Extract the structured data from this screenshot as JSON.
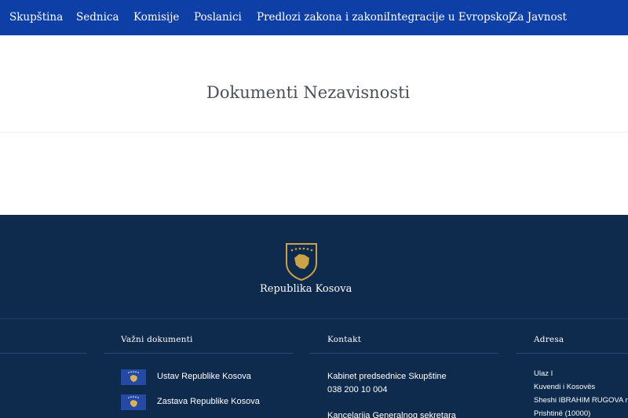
{
  "nav": {
    "items": [
      {
        "label": "Skupština"
      },
      {
        "label": "Sednica"
      },
      {
        "label": "Komisije"
      },
      {
        "label": "Poslanici"
      },
      {
        "label": "Predlozi zakona i zakoni"
      },
      {
        "label": "Integracije u Evropskoj"
      },
      {
        "label": "Za Javnost"
      }
    ]
  },
  "page": {
    "title": "Dokumenti Nezavisnosti"
  },
  "footer": {
    "emblem_icon": "kosovo-coat-of-arms-icon",
    "republic_name": "Republika Kosova",
    "colors": {
      "navbar": "#0d3fa6",
      "footer": "#0e2a4d",
      "emblem_gold": "#c9a24a"
    },
    "columns": {
      "documents": {
        "heading": "Važni dokumenti",
        "items": [
          {
            "label": "Ustav Republike Kosova",
            "icon": "kosovo-flag-icon"
          },
          {
            "label": "Zastava Republike Kosova",
            "icon": "kosovo-flag-icon"
          }
        ]
      },
      "contact": {
        "heading": "Kontakt",
        "lines": [
          "Kabinet predsednice Skupštine",
          "038 200 10 004",
          "Kancelarija Generalnog sekretara"
        ]
      },
      "address": {
        "heading": "Adresa",
        "lines": [
          "Ulaz I",
          "Kuvendi i Kosovës",
          "Sheshi IBRAHIM RUGOVA n",
          "Prishtinë (10000)"
        ]
      }
    }
  }
}
